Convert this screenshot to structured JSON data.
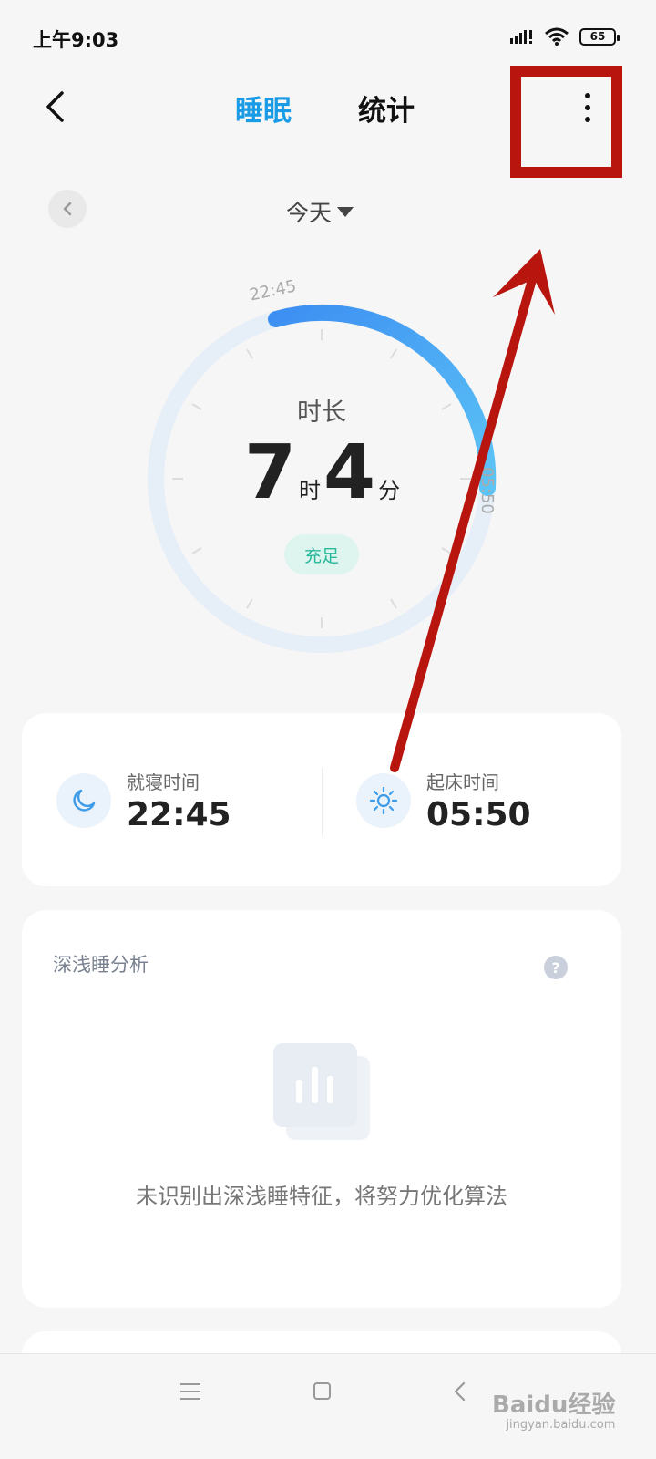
{
  "status_bar": {
    "time": "上午9:03",
    "battery": "65",
    "icons": [
      "signal-icon",
      "wifi-icon",
      "battery-icon"
    ]
  },
  "header": {
    "back_icon": "chevron-left-icon",
    "tabs": [
      {
        "label": "睡眠",
        "active": true
      },
      {
        "label": "统计",
        "active": false
      }
    ],
    "menu_icon": "more-vertical-icon",
    "accent_color": "#1a9be6"
  },
  "date_selector": {
    "label": "今天",
    "prev_icon": "chevron-left-icon",
    "dropdown_icon": "caret-down-icon"
  },
  "dial": {
    "start_label": "22:45",
    "end_label": "05:50",
    "duration_label": "时长",
    "hours": "7",
    "hours_unit": "时",
    "minutes": "4",
    "minutes_unit": "分",
    "quality": "充足"
  },
  "times": {
    "bedtime_label": "就寝时间",
    "bedtime_value": "22:45",
    "bedtime_icon": "moon-icon",
    "wake_label": "起床时间",
    "wake_value": "05:50",
    "wake_icon": "sun-icon"
  },
  "analysis": {
    "title": "深浅睡分析",
    "help_icon": "help-icon",
    "help_glyph": "?",
    "empty_icon": "bar-chart-icon",
    "empty_text": "未识别出深浅睡特征，将努力优化算法"
  },
  "nav_bar": {
    "icons": [
      "menu-icon",
      "home-icon",
      "back-icon"
    ]
  },
  "watermark": {
    "main": "Baidu经验",
    "sub": "jingyan.baidu.com"
  },
  "annotation": {
    "box_color": "#b8150f",
    "arrow_color": "#b8150f"
  }
}
